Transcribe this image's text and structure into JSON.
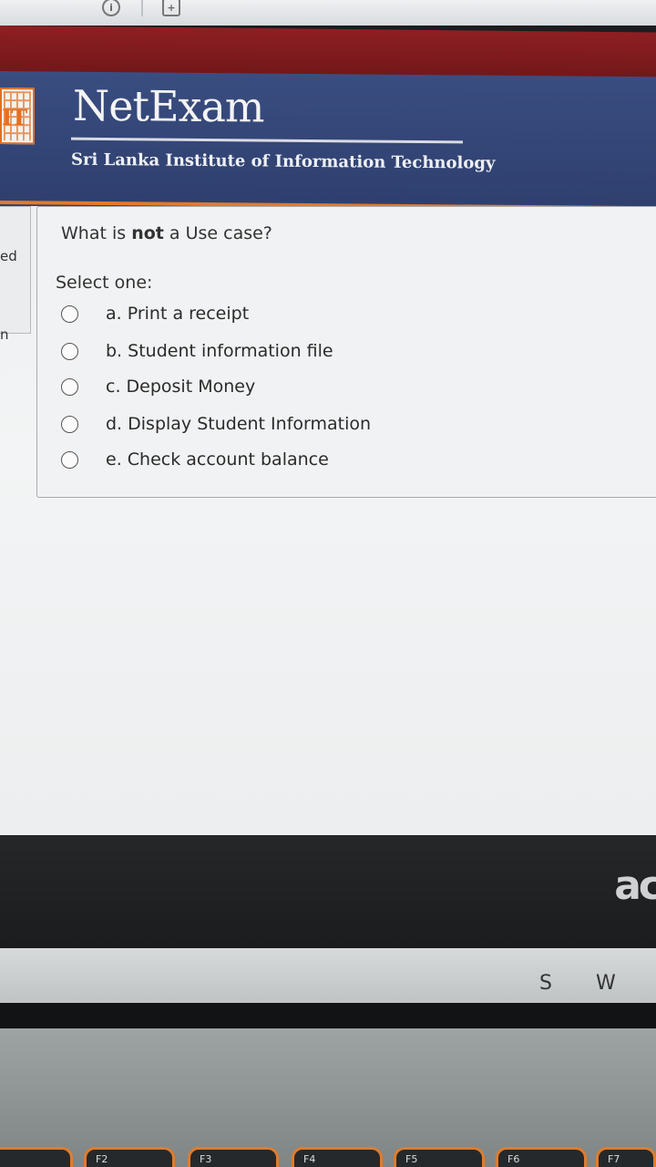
{
  "browser": {
    "info_icon": "i",
    "add_icon": "+"
  },
  "header": {
    "logo_text": "IT",
    "brand": "NetExam",
    "institute": "Sri Lanka Institute of Information Technology"
  },
  "sidebar": {
    "fragment_1": "ed",
    "fragment_2": "n"
  },
  "question": {
    "text_before": "What is ",
    "text_bold": "not",
    "text_after": " a Use case?",
    "select_label": "Select one:",
    "options": [
      {
        "label": "a. Print a receipt",
        "selected": false
      },
      {
        "label": "b. Student information file",
        "selected": false
      },
      {
        "label": "c. Deposit Money",
        "selected": false
      },
      {
        "label": "d. Display Student Information",
        "selected": false
      },
      {
        "label": "e. Check account balance",
        "selected": false
      }
    ]
  },
  "laptop": {
    "brand": "ac",
    "keys": [
      "S",
      "W"
    ],
    "fkeys": [
      "F2",
      "F3",
      "F4",
      "F5",
      "F6",
      "F7"
    ]
  },
  "colors": {
    "header_blue": "#33467a",
    "accent_orange": "#e47a2a",
    "top_red": "#7d1b1d"
  }
}
